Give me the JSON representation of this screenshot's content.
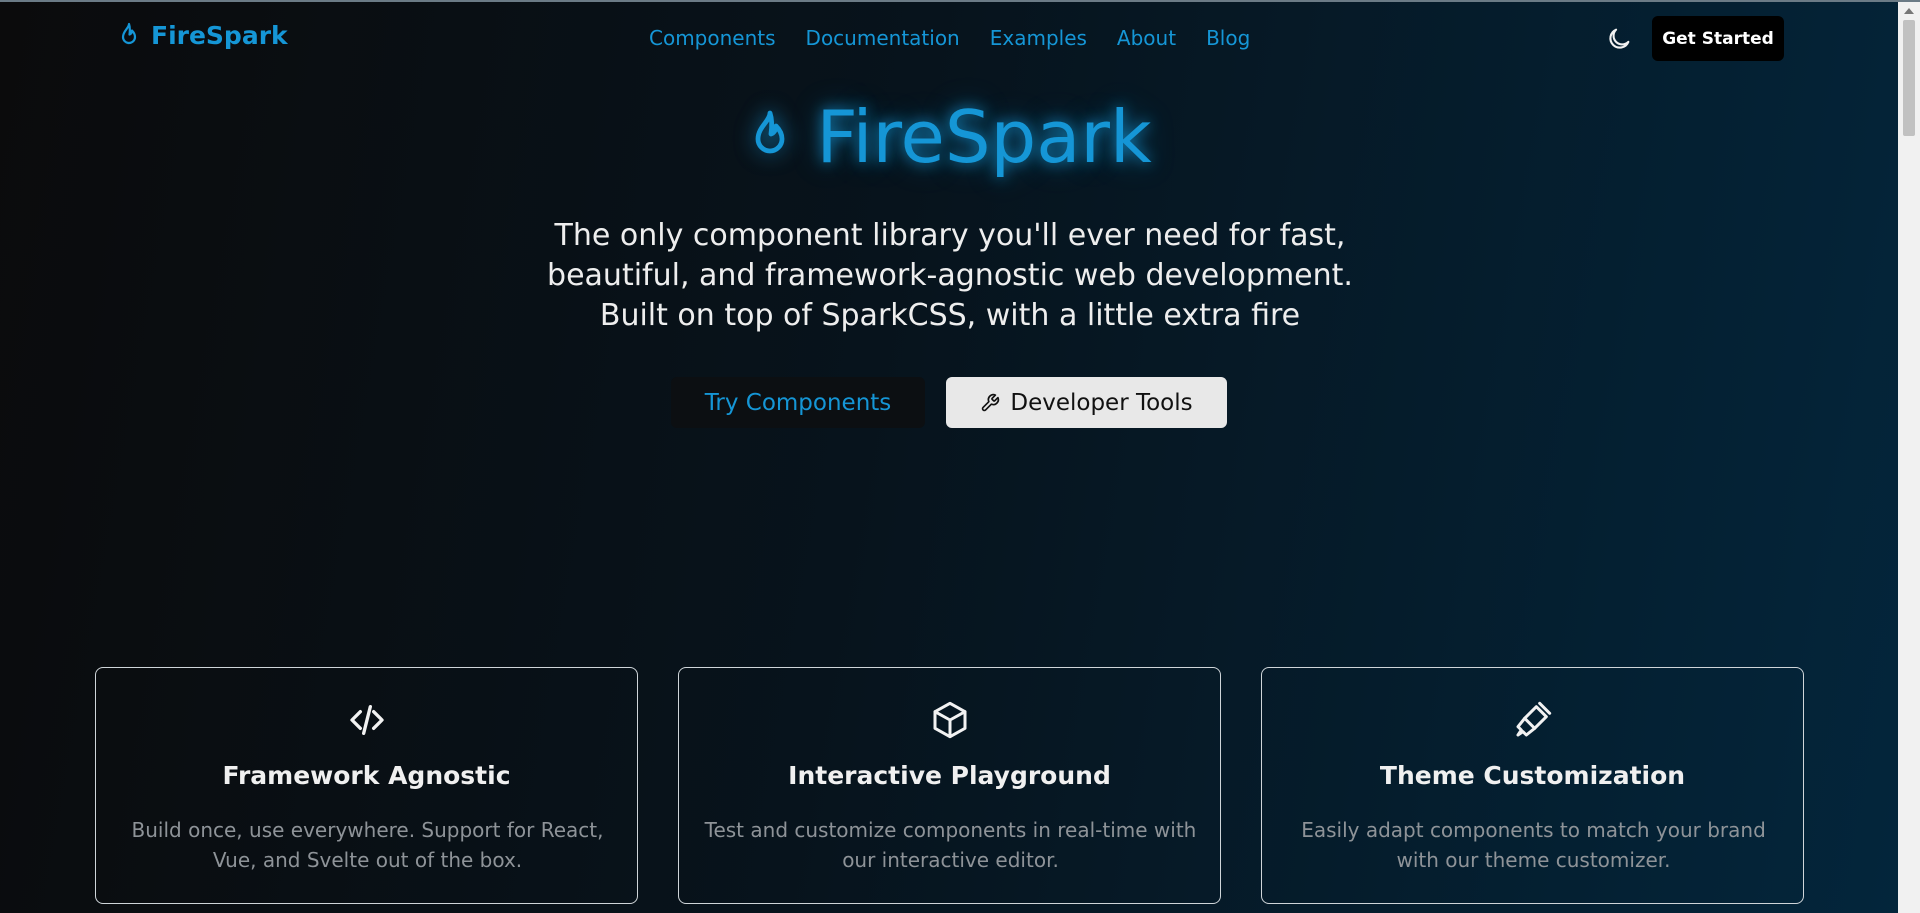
{
  "app": {
    "name": "FireSpark"
  },
  "header": {
    "logo_text": "FireSpark",
    "nav": [
      {
        "label": "Components"
      },
      {
        "label": "Documentation"
      },
      {
        "label": "Examples"
      },
      {
        "label": "About"
      },
      {
        "label": "Blog"
      }
    ],
    "theme_toggle_icon": "moon-icon",
    "cta_label": "Get Started"
  },
  "hero": {
    "title": "FireSpark",
    "title_icon": "flame-icon",
    "description": "The only component library you'll ever need for fast, beautiful, and framework-agnostic web development. Built on top of SparkCSS, with a little extra fire",
    "primary_button": "Try Components",
    "secondary_button": "Developer Tools",
    "secondary_icon": "wrench-icon"
  },
  "features": [
    {
      "icon": "code-icon",
      "title": "Framework Agnostic",
      "description": "Build once, use everywhere. Support for React, Vue, and Svelte out of the box."
    },
    {
      "icon": "cube-icon",
      "title": "Interactive Playground",
      "description": "Test and customize components in real-time with our interactive editor."
    },
    {
      "icon": "paintbrush-icon",
      "title": "Theme Customization",
      "description": "Easily adapt components to match your brand with our theme customizer."
    }
  ],
  "colors": {
    "accent": "#1596d6",
    "background_start": "#0b0b0c",
    "background_end": "#03263c",
    "card_border": "#cfd5d9",
    "muted_text": "#8e9398"
  }
}
